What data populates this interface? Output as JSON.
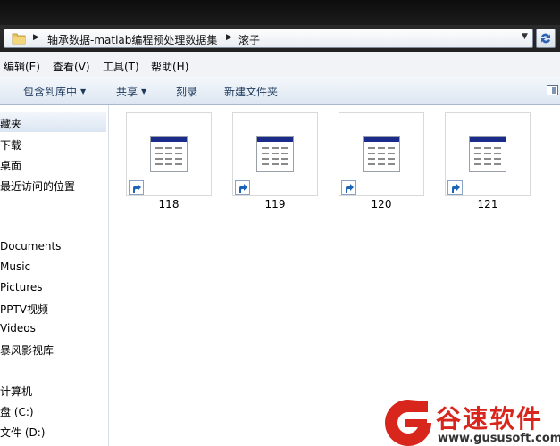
{
  "address_bar": {
    "crumbs": [
      "轴承数据-matlab编程预处理数据集",
      "滚子"
    ]
  },
  "menu": {
    "items": [
      "编辑(E)",
      "查看(V)",
      "工具(T)",
      "帮助(H)"
    ]
  },
  "toolbar": {
    "include_library": "包含到库中",
    "share": "共享",
    "burn": "刻录",
    "new_folder": "新建文件夹"
  },
  "nav": {
    "items": [
      "藏夹",
      "下载",
      "桌面",
      "最近访问的位置",
      "Documents",
      "Music",
      "Pictures",
      "PPTV视频",
      "Videos",
      "暴风影视库",
      "计算机",
      "盘 (C:)",
      "文件 (D:)"
    ]
  },
  "files": [
    {
      "name": "118"
    },
    {
      "name": "119"
    },
    {
      "name": "120"
    },
    {
      "name": "121"
    }
  ],
  "watermark": {
    "title": "谷速软件",
    "url": "www.gususoft.com"
  },
  "colors": {
    "watermark_red": "#d9261c",
    "doc_header_blue": "#1b2b8a"
  }
}
